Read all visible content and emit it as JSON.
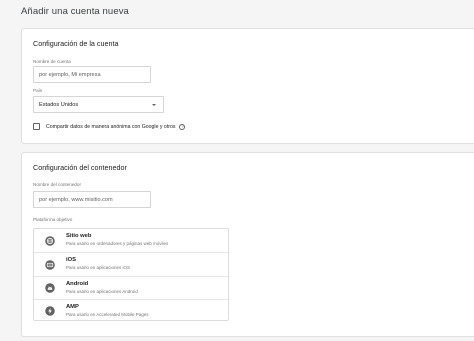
{
  "page": {
    "title": "Añadir una cuenta nueva"
  },
  "account_settings": {
    "title": "Configuración de la cuenta",
    "account_name": {
      "label": "Nombre de cuenta",
      "placeholder": "por ejemplo, Mi empresa"
    },
    "country": {
      "label": "País",
      "selected": "Estados Unidos"
    },
    "share_data": {
      "label": "Compartir datos de manera anónima con Google y otros",
      "checked": false
    }
  },
  "container_settings": {
    "title": "Configuración del contenedor",
    "container_name": {
      "label": "Nombre del contenedor",
      "placeholder": "por ejemplo, www.misitio.com"
    },
    "target_platform": {
      "label": "Plataforma objetivo",
      "options": [
        {
          "name": "Sitio web",
          "description": "Para usarlo en ordenadores y páginas web móviles",
          "icon": "globe-icon"
        },
        {
          "name": "iOS",
          "description": "Para usarlo en aplicaciones iOS",
          "icon": "ios-device-icon"
        },
        {
          "name": "Android",
          "description": "Para usarlo en aplicaciones Android",
          "icon": "android-icon"
        },
        {
          "name": "AMP",
          "description": "Para usarlo en Accelerated Mobile Pages",
          "icon": "amp-bolt-icon"
        }
      ]
    }
  },
  "colors": {
    "icon": "#616161",
    "border": "#e0e0e0",
    "text": "#212121",
    "muted": "#757575"
  }
}
